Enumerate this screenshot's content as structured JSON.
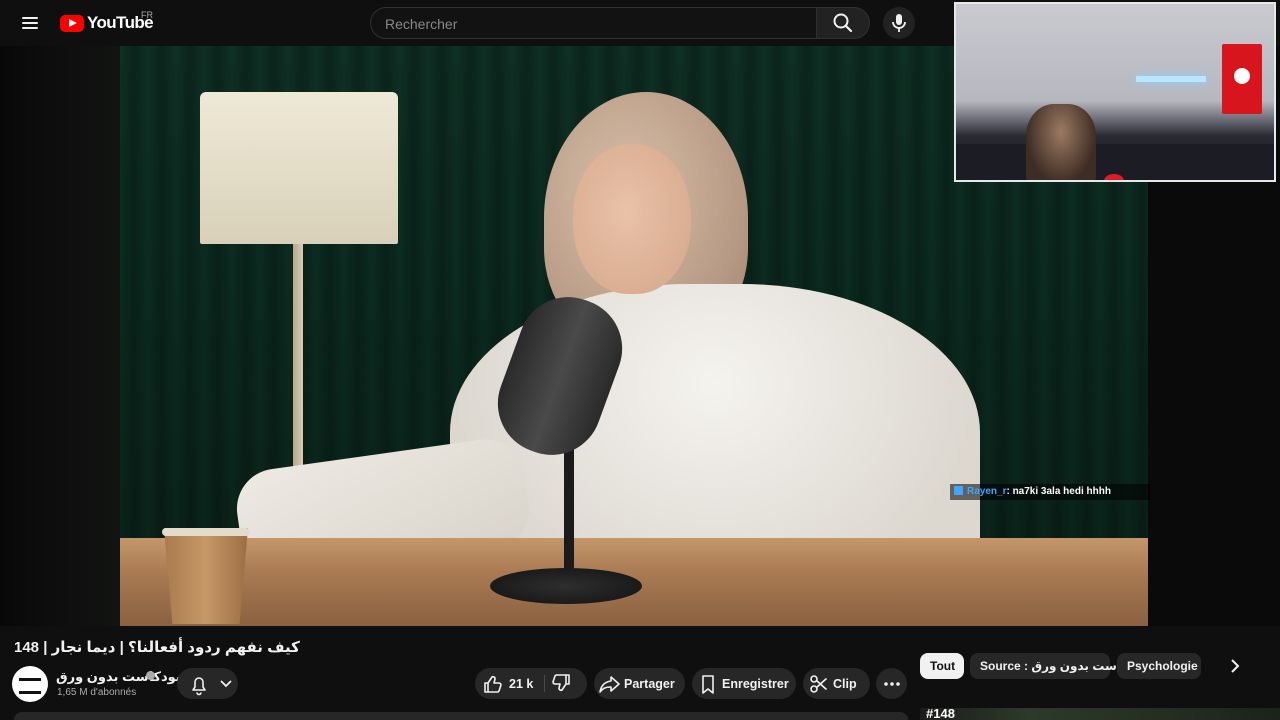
{
  "header": {
    "logo_text": "YouTube",
    "country_code": "FR",
    "search_placeholder": "Rechercher"
  },
  "overlay": {
    "chat_user": "Rayen_r",
    "chat_message": ": na7ki 3ala hedi hhhh"
  },
  "video": {
    "title": "كيف نفهم ردود أفعالنا؟ | ديما نجار | 148",
    "channel_name": "بودكاست بدون ورق",
    "subscribers": "1,65 M d'abonnés"
  },
  "actions": {
    "likes": "21 k",
    "share_label": "Partager",
    "save_label": "Enregistrer",
    "clip_label": "Clip"
  },
  "chips": [
    "Tout",
    "Source : بودكاست بدون ورق",
    "Psychologie"
  ],
  "next_video": {
    "number": "#148"
  },
  "colors": {
    "brand": "#ff0000",
    "background": "#0f0f0f",
    "pill": "#272727",
    "chat_user": "#3ea6ff"
  }
}
